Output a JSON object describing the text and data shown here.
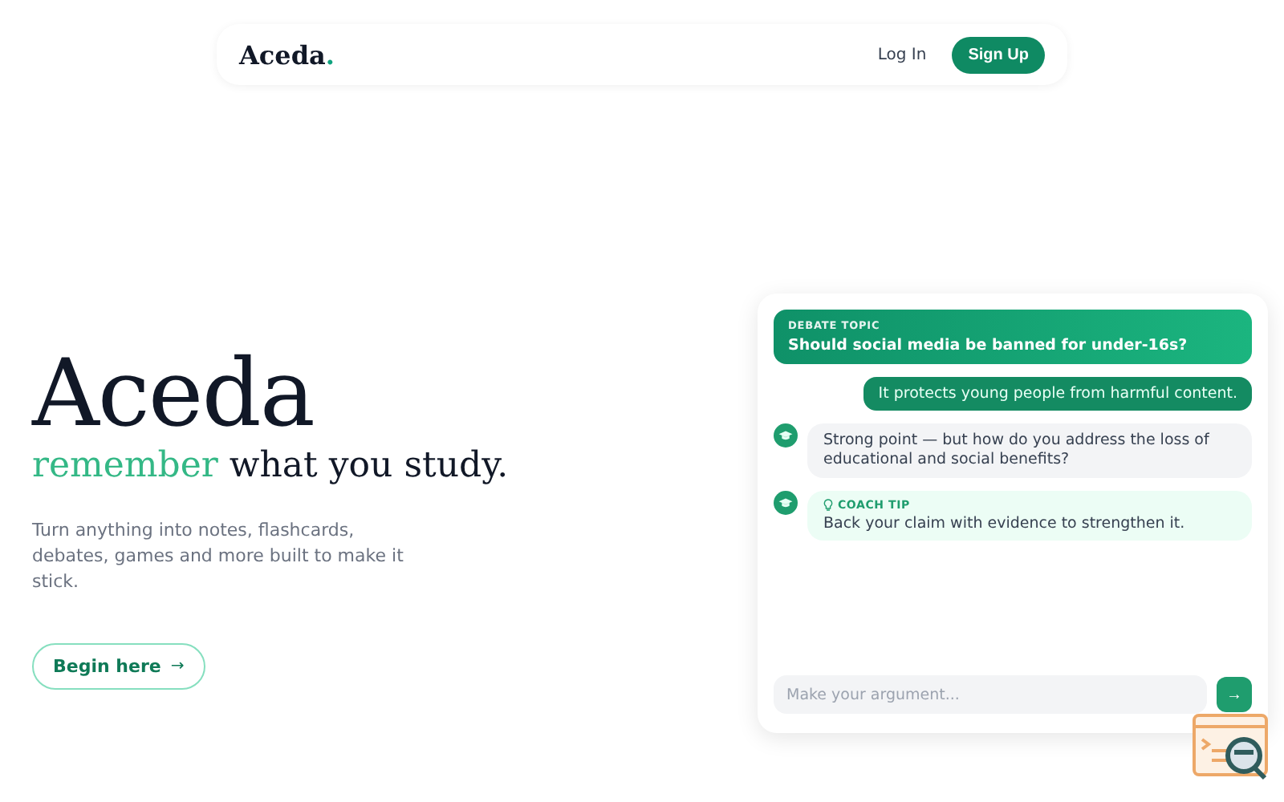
{
  "nav": {
    "logo": "Aceda",
    "logo_dot": ".",
    "links": [
      {
        "label": "Log In",
        "kind": "link"
      },
      {
        "label": "Sign Up",
        "kind": "primary"
      }
    ]
  },
  "hero": {
    "title": "Aceda",
    "tagline_accent": "remember",
    "tagline_rest": "what you study.",
    "description": "Turn anything into notes, flashcards, debates, games and more built to make it stick.",
    "cta": "Begin here",
    "cta_icon": "→"
  },
  "chat": {
    "messages": [
      {
        "kind": "topic",
        "label": "DEBATE TOPIC",
        "text": "Should social media be banned for under-16s?"
      },
      {
        "kind": "user",
        "text": "It protects young people from harmful content."
      },
      {
        "kind": "bot",
        "text": "Strong point — but how do you address the loss of educational and social benefits?"
      },
      {
        "kind": "tip",
        "label": "COACH TIP",
        "text": "Back your claim with evidence to strengthen it."
      }
    ],
    "input": {
      "placeholder": "Make your argument..."
    },
    "send_icon": "→"
  }
}
